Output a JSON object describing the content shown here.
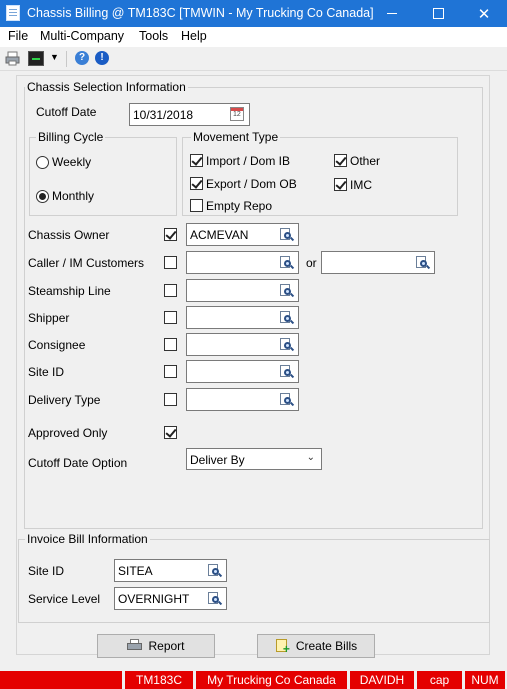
{
  "window": {
    "title": "Chassis Billing @ TM183C [TMWIN - My Trucking Co Canada]"
  },
  "menu": [
    "File",
    "Multi-Company",
    "Tools",
    "Help"
  ],
  "toolbar": {
    "help_glyph": "?",
    "info_glyph": "!"
  },
  "chassis_selection": {
    "group_title": "Chassis Selection Information",
    "cutoff_date": {
      "label": "Cutoff Date",
      "value": "10/31/2018",
      "calendar_glyph": "12"
    },
    "billing_cycle": {
      "title": "Billing Cycle",
      "options": [
        {
          "label": "Weekly",
          "selected": false
        },
        {
          "label": "Monthly",
          "selected": true
        }
      ]
    },
    "movement_type": {
      "title": "Movement Type",
      "options": [
        {
          "label": "Import / Dom IB",
          "checked": true
        },
        {
          "label": "Other",
          "checked": true
        },
        {
          "label": "Export / Dom OB",
          "checked": true
        },
        {
          "label": "IMC",
          "checked": true
        },
        {
          "label": "Empty Repo",
          "checked": false
        }
      ]
    },
    "filters": [
      {
        "label": "Chassis Owner",
        "checked": true,
        "value": "ACMEVAN"
      },
      {
        "label": "Caller / IM Customers",
        "checked": false,
        "value": "",
        "or_label": "or",
        "value2": ""
      },
      {
        "label": "Steamship Line",
        "checked": false,
        "value": ""
      },
      {
        "label": "Shipper",
        "checked": false,
        "value": ""
      },
      {
        "label": "Consignee",
        "checked": false,
        "value": ""
      },
      {
        "label": "Site ID",
        "checked": false,
        "value": ""
      },
      {
        "label": "Delivery Type",
        "checked": false,
        "value": ""
      }
    ],
    "approved_only": {
      "label": "Approved Only",
      "checked": true
    },
    "cutoff_date_option": {
      "label": "Cutoff Date Option",
      "value": "Deliver By"
    }
  },
  "invoice_bill": {
    "group_title": "Invoice Bill Information",
    "site_id": {
      "label": "Site ID",
      "value": "SITEA"
    },
    "service_level": {
      "label": "Service Level",
      "value": "OVERNIGHT"
    }
  },
  "buttons": {
    "report": "Report",
    "create_bills": "Create Bills"
  },
  "status": [
    "TM183C",
    "My Trucking Co Canada",
    "DAVIDH",
    "cap",
    "NUM"
  ],
  "colors": {
    "titlebar": "#1f74d6",
    "status": "#e40000"
  }
}
